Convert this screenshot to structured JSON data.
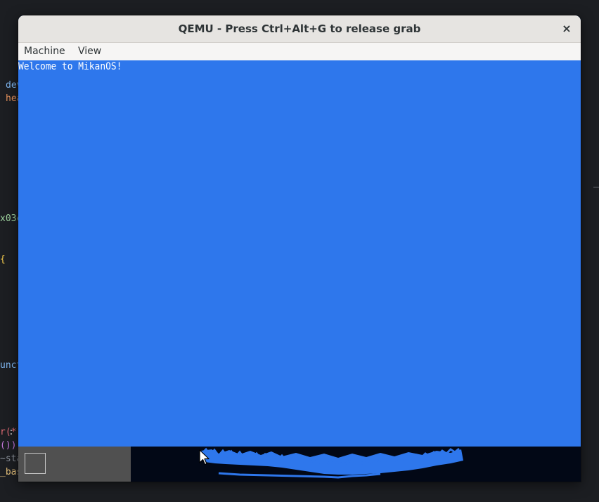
{
  "background_code": {
    "frag1": "dev",
    "frag2": "hea",
    "frag3": "x03c",
    "frag4": "{",
    "frag5": "unct",
    "frag6": "r(*",
    "frag6b": ":",
    "frag7": "())",
    "frag8": "~sta",
    "frag9": "_bas"
  },
  "window": {
    "title": "QEMU - Press Ctrl+Alt+G to release grab",
    "close_glyph": "×"
  },
  "menu": {
    "items": [
      {
        "label": "Machine"
      },
      {
        "label": "View"
      }
    ]
  },
  "screen": {
    "console_text": "Welcome to MikanOS!"
  },
  "colors": {
    "screen_bg": "#2e77ec",
    "taskbar_bg": "#020816",
    "taskbar_left_bg": "#505050",
    "titlebar_bg": "#e6e4e1",
    "menubar_bg": "#f6f5f4"
  },
  "icons": {
    "close": "close-icon",
    "cursor": "mouse-cursor-icon",
    "start": "start-button"
  }
}
